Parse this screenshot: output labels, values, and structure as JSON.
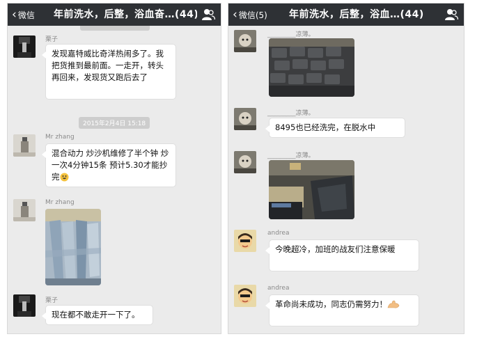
{
  "left_screen": {
    "back_label": "微信",
    "title": "年前洗水，后整，浴血奋…(44)",
    "messages": [
      {
        "sender": "栗子",
        "text": "发现嘉特威比奇洋热闹多了。我把货推到最前面。一走开，转头再回来，发现货又跑后去了"
      },
      {
        "timestamp": "2015年2月4日 15:18"
      },
      {
        "sender": "Mr  zhang",
        "text": "混合动力 炒沙机维修了半个钟 炒一次4分钟15条  预计5.30才能抄完"
      },
      {
        "sender": "Mr  zhang",
        "image": "jeans-pile-photo"
      },
      {
        "sender": "栗子",
        "text": "现在都不敢走开一下了。"
      }
    ]
  },
  "right_screen": {
    "back_label": "微信(5)",
    "title": "年前洗水，后整，浴血…(44)",
    "messages": [
      {
        "sender": "_________凉薄。",
        "image": "folded-jeans-photo"
      },
      {
        "sender": "_________凉薄。",
        "text": "8495也已经洗完，在脱水中"
      },
      {
        "sender": "_________凉薄。",
        "image": "factory-machine-photo"
      },
      {
        "sender": "andrea",
        "text": "今晚超冷，加班的战友们注意保暖"
      },
      {
        "sender": "andrea",
        "text": "革命尚未成功，同志仍需努力！",
        "emoji": "flexed-biceps"
      }
    ]
  },
  "colors": {
    "navbar_bg": "#2e3135",
    "chat_bg": "#ebebeb",
    "bubble_bg": "#ffffff",
    "timestamp_bg": "#cdcdcd"
  }
}
